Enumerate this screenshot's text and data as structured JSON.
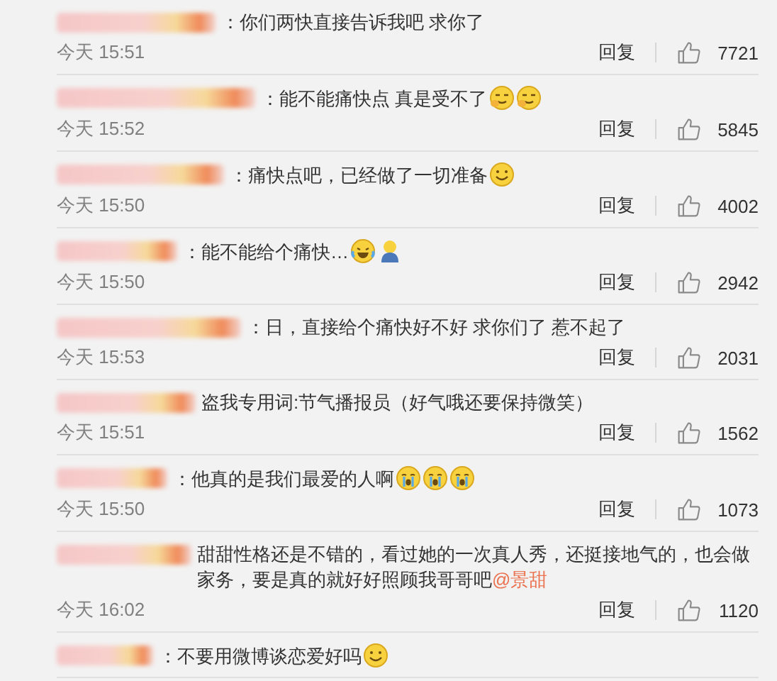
{
  "comments": [
    {
      "text": "：你们两快直接告诉我吧  求你了",
      "time": "今天 15:51",
      "reply": "回复",
      "likes": "7721"
    },
    {
      "text": "：能不能痛快点 真是受不了",
      "emojis": [
        {
          "kind": "smirk"
        },
        {
          "kind": "smirk"
        }
      ],
      "time": "今天 15:52",
      "reply": "回复",
      "likes": "5845"
    },
    {
      "text": "：痛快点吧，已经做了一切准备",
      "emojis": [
        {
          "kind": "smile"
        }
      ],
      "time": "今天 15:50",
      "reply": "回复",
      "likes": "4002"
    },
    {
      "text": "：能不能给个痛快…",
      "emojis": [
        {
          "kind": "laugh-cry"
        },
        {
          "kind": "figure"
        }
      ],
      "time": "今天 15:50",
      "reply": "回复",
      "likes": "2942"
    },
    {
      "text": "：日，直接给个痛快好不好  求你们了  惹不起了",
      "time": "今天 15:53",
      "reply": "回复",
      "likes": "2031"
    },
    {
      "text": "盗我专用词:节气播报员（好气哦还要保持微笑）",
      "time": "今天 15:51",
      "reply": "回复",
      "likes": "1562"
    },
    {
      "text": "：他真的是我们最爱的人啊",
      "emojis": [
        {
          "kind": "cry"
        },
        {
          "kind": "cry"
        },
        {
          "kind": "cry"
        }
      ],
      "time": "今天 15:50",
      "reply": "回复",
      "likes": "1073"
    },
    {
      "text": "甜甜性格还是不错的，看过她的一次真人秀，还挺接地气的，也会做家务，要是真的就好好照顾我哥哥吧",
      "mention": "@景甜",
      "time": "今天 16:02",
      "reply": "回复",
      "likes": "1120"
    },
    {
      "text": "：不要用微博谈恋爱好吗",
      "emojis": [
        {
          "kind": "smile"
        }
      ]
    }
  ]
}
